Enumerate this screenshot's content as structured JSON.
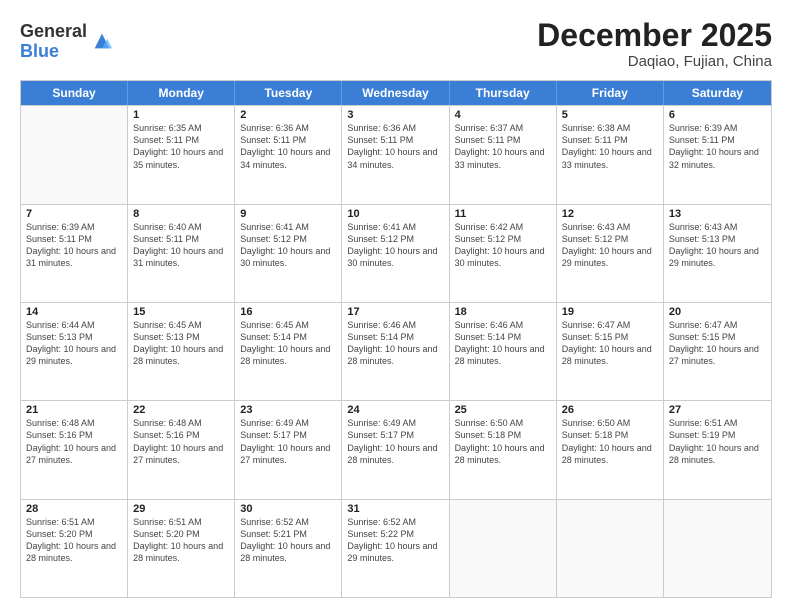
{
  "logo": {
    "general": "General",
    "blue": "Blue"
  },
  "header": {
    "month": "December 2025",
    "location": "Daqiao, Fujian, China"
  },
  "days": [
    "Sunday",
    "Monday",
    "Tuesday",
    "Wednesday",
    "Thursday",
    "Friday",
    "Saturday"
  ],
  "rows": [
    [
      {
        "day": "",
        "empty": true
      },
      {
        "day": "1",
        "sunrise": "Sunrise: 6:35 AM",
        "sunset": "Sunset: 5:11 PM",
        "daylight": "Daylight: 10 hours and 35 minutes."
      },
      {
        "day": "2",
        "sunrise": "Sunrise: 6:36 AM",
        "sunset": "Sunset: 5:11 PM",
        "daylight": "Daylight: 10 hours and 34 minutes."
      },
      {
        "day": "3",
        "sunrise": "Sunrise: 6:36 AM",
        "sunset": "Sunset: 5:11 PM",
        "daylight": "Daylight: 10 hours and 34 minutes."
      },
      {
        "day": "4",
        "sunrise": "Sunrise: 6:37 AM",
        "sunset": "Sunset: 5:11 PM",
        "daylight": "Daylight: 10 hours and 33 minutes."
      },
      {
        "day": "5",
        "sunrise": "Sunrise: 6:38 AM",
        "sunset": "Sunset: 5:11 PM",
        "daylight": "Daylight: 10 hours and 33 minutes."
      },
      {
        "day": "6",
        "sunrise": "Sunrise: 6:39 AM",
        "sunset": "Sunset: 5:11 PM",
        "daylight": "Daylight: 10 hours and 32 minutes."
      }
    ],
    [
      {
        "day": "7",
        "sunrise": "Sunrise: 6:39 AM",
        "sunset": "Sunset: 5:11 PM",
        "daylight": "Daylight: 10 hours and 31 minutes."
      },
      {
        "day": "8",
        "sunrise": "Sunrise: 6:40 AM",
        "sunset": "Sunset: 5:11 PM",
        "daylight": "Daylight: 10 hours and 31 minutes."
      },
      {
        "day": "9",
        "sunrise": "Sunrise: 6:41 AM",
        "sunset": "Sunset: 5:12 PM",
        "daylight": "Daylight: 10 hours and 30 minutes."
      },
      {
        "day": "10",
        "sunrise": "Sunrise: 6:41 AM",
        "sunset": "Sunset: 5:12 PM",
        "daylight": "Daylight: 10 hours and 30 minutes."
      },
      {
        "day": "11",
        "sunrise": "Sunrise: 6:42 AM",
        "sunset": "Sunset: 5:12 PM",
        "daylight": "Daylight: 10 hours and 30 minutes."
      },
      {
        "day": "12",
        "sunrise": "Sunrise: 6:43 AM",
        "sunset": "Sunset: 5:12 PM",
        "daylight": "Daylight: 10 hours and 29 minutes."
      },
      {
        "day": "13",
        "sunrise": "Sunrise: 6:43 AM",
        "sunset": "Sunset: 5:13 PM",
        "daylight": "Daylight: 10 hours and 29 minutes."
      }
    ],
    [
      {
        "day": "14",
        "sunrise": "Sunrise: 6:44 AM",
        "sunset": "Sunset: 5:13 PM",
        "daylight": "Daylight: 10 hours and 29 minutes."
      },
      {
        "day": "15",
        "sunrise": "Sunrise: 6:45 AM",
        "sunset": "Sunset: 5:13 PM",
        "daylight": "Daylight: 10 hours and 28 minutes."
      },
      {
        "day": "16",
        "sunrise": "Sunrise: 6:45 AM",
        "sunset": "Sunset: 5:14 PM",
        "daylight": "Daylight: 10 hours and 28 minutes."
      },
      {
        "day": "17",
        "sunrise": "Sunrise: 6:46 AM",
        "sunset": "Sunset: 5:14 PM",
        "daylight": "Daylight: 10 hours and 28 minutes."
      },
      {
        "day": "18",
        "sunrise": "Sunrise: 6:46 AM",
        "sunset": "Sunset: 5:14 PM",
        "daylight": "Daylight: 10 hours and 28 minutes."
      },
      {
        "day": "19",
        "sunrise": "Sunrise: 6:47 AM",
        "sunset": "Sunset: 5:15 PM",
        "daylight": "Daylight: 10 hours and 28 minutes."
      },
      {
        "day": "20",
        "sunrise": "Sunrise: 6:47 AM",
        "sunset": "Sunset: 5:15 PM",
        "daylight": "Daylight: 10 hours and 27 minutes."
      }
    ],
    [
      {
        "day": "21",
        "sunrise": "Sunrise: 6:48 AM",
        "sunset": "Sunset: 5:16 PM",
        "daylight": "Daylight: 10 hours and 27 minutes."
      },
      {
        "day": "22",
        "sunrise": "Sunrise: 6:48 AM",
        "sunset": "Sunset: 5:16 PM",
        "daylight": "Daylight: 10 hours and 27 minutes."
      },
      {
        "day": "23",
        "sunrise": "Sunrise: 6:49 AM",
        "sunset": "Sunset: 5:17 PM",
        "daylight": "Daylight: 10 hours and 27 minutes."
      },
      {
        "day": "24",
        "sunrise": "Sunrise: 6:49 AM",
        "sunset": "Sunset: 5:17 PM",
        "daylight": "Daylight: 10 hours and 28 minutes."
      },
      {
        "day": "25",
        "sunrise": "Sunrise: 6:50 AM",
        "sunset": "Sunset: 5:18 PM",
        "daylight": "Daylight: 10 hours and 28 minutes."
      },
      {
        "day": "26",
        "sunrise": "Sunrise: 6:50 AM",
        "sunset": "Sunset: 5:18 PM",
        "daylight": "Daylight: 10 hours and 28 minutes."
      },
      {
        "day": "27",
        "sunrise": "Sunrise: 6:51 AM",
        "sunset": "Sunset: 5:19 PM",
        "daylight": "Daylight: 10 hours and 28 minutes."
      }
    ],
    [
      {
        "day": "28",
        "sunrise": "Sunrise: 6:51 AM",
        "sunset": "Sunset: 5:20 PM",
        "daylight": "Daylight: 10 hours and 28 minutes."
      },
      {
        "day": "29",
        "sunrise": "Sunrise: 6:51 AM",
        "sunset": "Sunset: 5:20 PM",
        "daylight": "Daylight: 10 hours and 28 minutes."
      },
      {
        "day": "30",
        "sunrise": "Sunrise: 6:52 AM",
        "sunset": "Sunset: 5:21 PM",
        "daylight": "Daylight: 10 hours and 28 minutes."
      },
      {
        "day": "31",
        "sunrise": "Sunrise: 6:52 AM",
        "sunset": "Sunset: 5:22 PM",
        "daylight": "Daylight: 10 hours and 29 minutes."
      },
      {
        "day": "",
        "empty": true
      },
      {
        "day": "",
        "empty": true
      },
      {
        "day": "",
        "empty": true
      }
    ]
  ]
}
